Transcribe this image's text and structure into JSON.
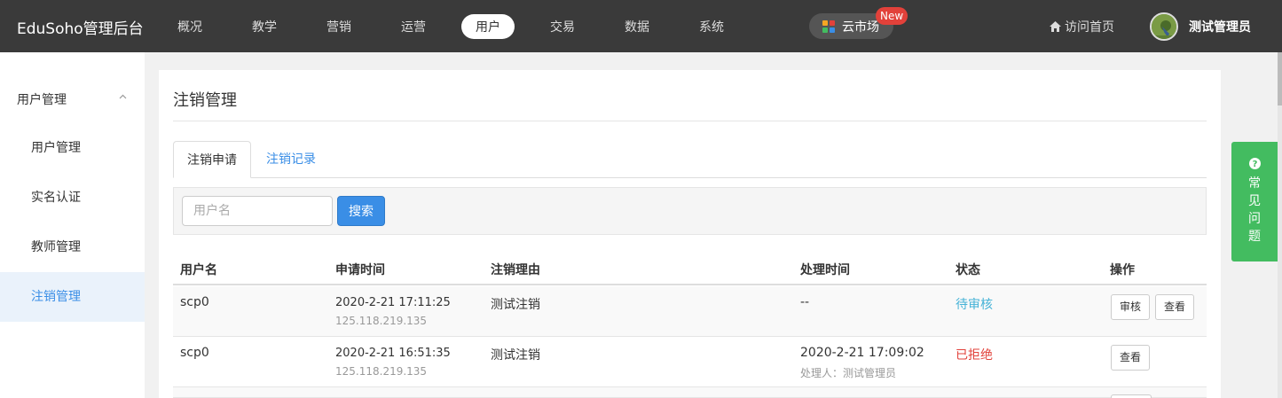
{
  "header": {
    "brand": "EduSoho管理后台",
    "nav": [
      "概况",
      "教学",
      "营销",
      "运营",
      "用户",
      "交易",
      "数据",
      "系统"
    ],
    "active_nav": "用户",
    "market_label": "云市场",
    "new_badge": "New",
    "visit_label": "访问首页",
    "user_name": "测试管理员"
  },
  "sidebar": {
    "group_label": "用户管理",
    "items": [
      "用户管理",
      "实名认证",
      "教师管理",
      "注销管理"
    ],
    "active": "注销管理"
  },
  "main": {
    "title": "注销管理",
    "tabs": [
      "注销申请",
      "注销记录"
    ],
    "search_placeholder": "用户名",
    "search_button": "搜索",
    "columns": [
      "用户名",
      "申请时间",
      "注销理由",
      "处理时间",
      "状态",
      "操作"
    ],
    "rows": [
      {
        "username": "scp0",
        "apply_time": "2020-2-21 17:11:25",
        "ip": "125.118.219.135",
        "reason": "测试注销",
        "handle_time": "--",
        "handler": "",
        "status": "待审核",
        "actions": [
          "审核",
          "查看"
        ]
      },
      {
        "username": "scp0",
        "apply_time": "2020-2-21 16:51:35",
        "ip": "125.118.219.135",
        "reason": "测试注销",
        "handle_time": "2020-2-21 17:09:02",
        "handler": "处理人：测试管理员",
        "status": "已拒绝",
        "actions": [
          "查看"
        ]
      }
    ]
  },
  "help": {
    "label": "常见问题"
  },
  "colors": {
    "topbar": "#3a3a3a",
    "accent": "#3a8ee6",
    "pending": "#46b3d7",
    "rejected": "#e2413a",
    "help": "#43bc60"
  }
}
